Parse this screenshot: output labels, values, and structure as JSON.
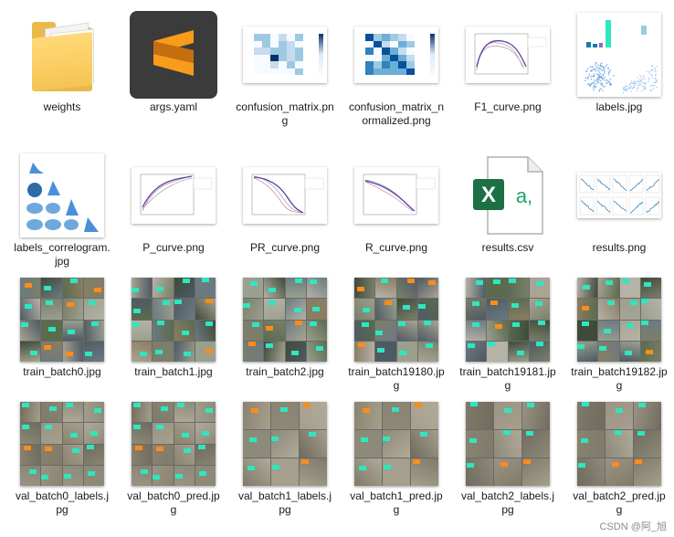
{
  "files": [
    {
      "name": "weights",
      "type": "folder"
    },
    {
      "name": "args.yaml",
      "type": "sublime"
    },
    {
      "name": "confusion_matrix.png",
      "type": "confusion"
    },
    {
      "name": "confusion_matrix_normalized.png",
      "type": "confusion_norm"
    },
    {
      "name": "F1_curve.png",
      "type": "curve"
    },
    {
      "name": "labels.jpg",
      "type": "labels"
    },
    {
      "name": "labels_correlogram.jpg",
      "type": "correlogram"
    },
    {
      "name": "P_curve.png",
      "type": "curve"
    },
    {
      "name": "PR_curve.png",
      "type": "curve"
    },
    {
      "name": "R_curve.png",
      "type": "curve"
    },
    {
      "name": "results.csv",
      "type": "excel"
    },
    {
      "name": "results.png",
      "type": "results"
    },
    {
      "name": "train_batch0.jpg",
      "type": "batch4"
    },
    {
      "name": "train_batch1.jpg",
      "type": "batch4"
    },
    {
      "name": "train_batch2.jpg",
      "type": "batch4"
    },
    {
      "name": "train_batch19180.jpg",
      "type": "batch4"
    },
    {
      "name": "train_batch19181.jpg",
      "type": "batch4"
    },
    {
      "name": "train_batch19182.jpg",
      "type": "batch4"
    },
    {
      "name": "val_batch0_labels.jpg",
      "type": "batch4"
    },
    {
      "name": "val_batch0_pred.jpg",
      "type": "batch4"
    },
    {
      "name": "val_batch1_labels.jpg",
      "type": "batch3"
    },
    {
      "name": "val_batch1_pred.jpg",
      "type": "batch3"
    },
    {
      "name": "val_batch2_labels.jpg",
      "type": "batch3"
    },
    {
      "name": "val_batch2_pred.jpg",
      "type": "batch3"
    }
  ],
  "icons": {
    "excel_letter": "X",
    "excel_suffix": "a,",
    "excel_color": "#1d7044",
    "sublime_color": "#f99b1b"
  },
  "watermark": "CSDN @阿_旭"
}
